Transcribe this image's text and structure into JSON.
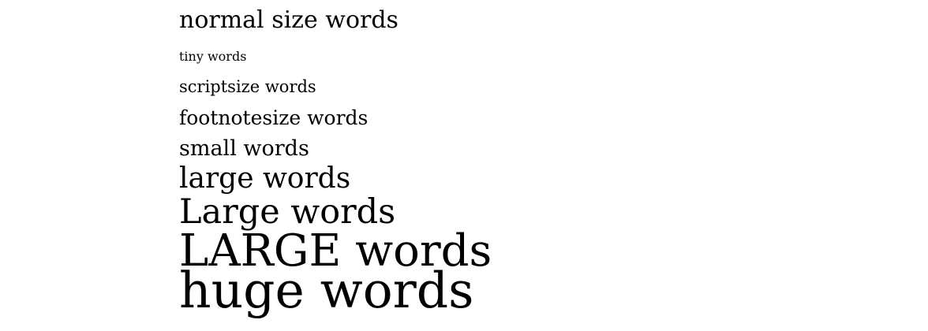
{
  "lines": [
    "normal size words",
    "tiny words",
    "scriptsize words",
    "footnotesize words",
    "small words",
    "large words",
    "Large words",
    "LARGE words",
    "huge words"
  ]
}
